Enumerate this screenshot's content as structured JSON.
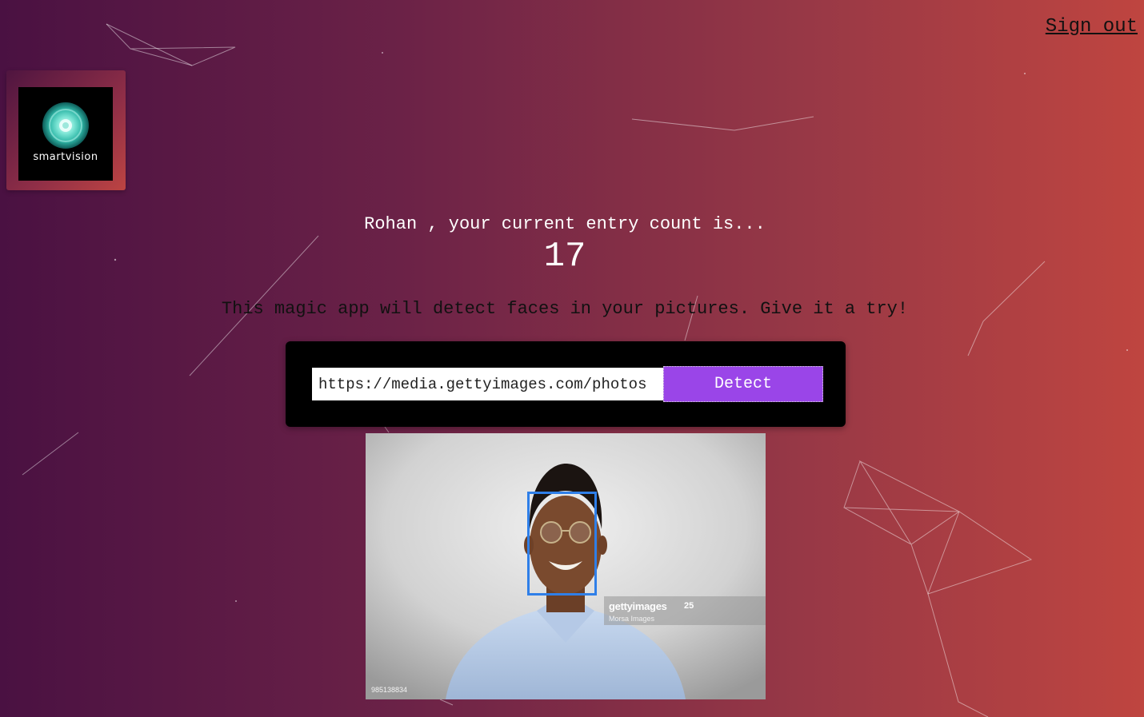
{
  "nav": {
    "sign_out_label": "Sign out"
  },
  "logo": {
    "brand_text": "smartvision",
    "icon": "concentric-circle-lens-icon"
  },
  "rank": {
    "greeting": "Rohan , your current entry count is...",
    "count": "17"
  },
  "form": {
    "tagline": "This magic app will detect faces in your pictures. Give it a try!",
    "url_value": "https://media.gettyimages.com/photos",
    "detect_label": "Detect"
  },
  "result_image": {
    "watermark_brand": "gettyimages",
    "watermark_years": "25",
    "watermark_credit": "Morsa Images",
    "image_number": "985138834",
    "face_box_color": "#2f7fe8"
  },
  "colors": {
    "gradient_start": "#4a1142",
    "gradient_end": "#bf4540",
    "button": "#9a45e8",
    "panel": "#000000"
  }
}
